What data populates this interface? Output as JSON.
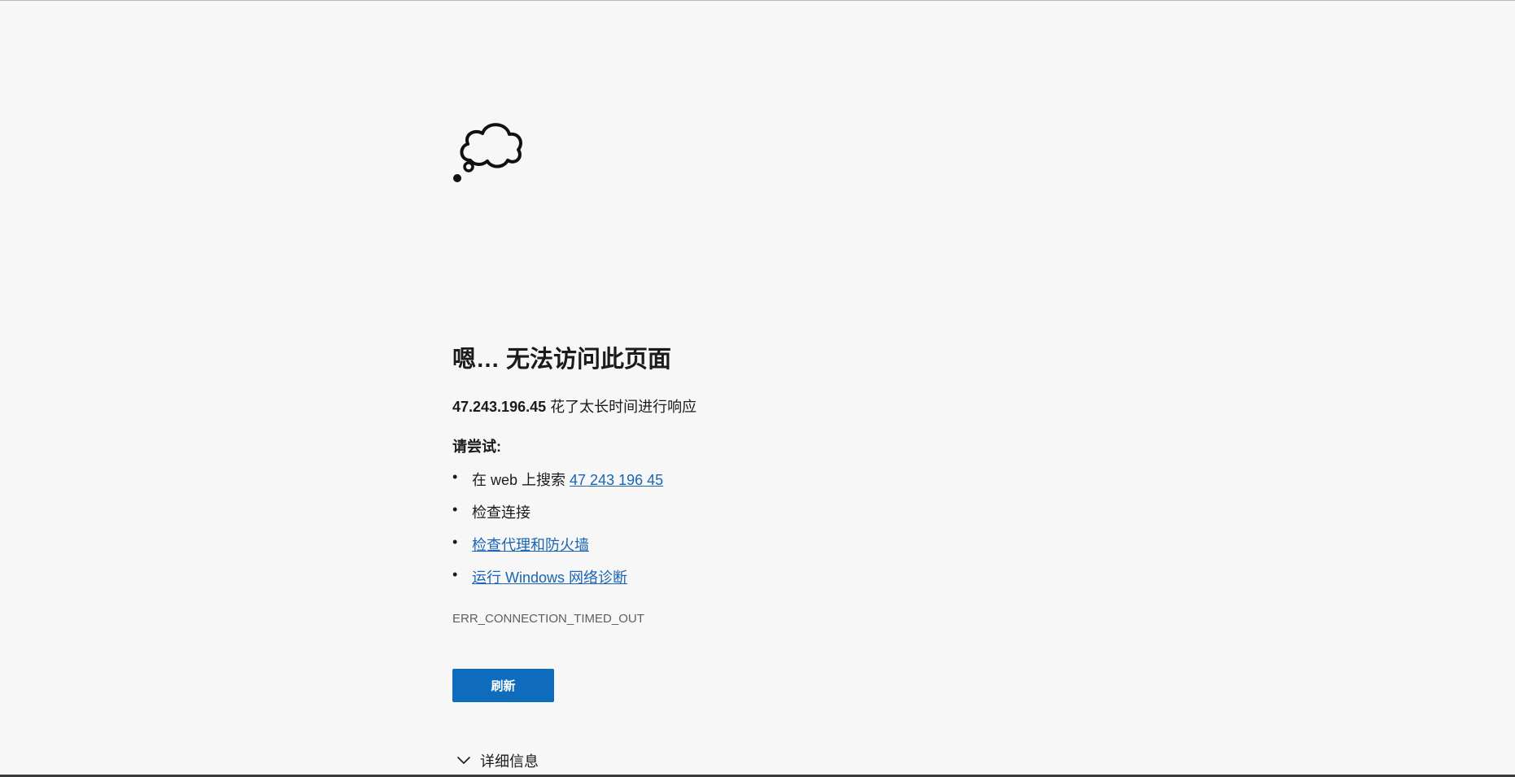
{
  "error_page": {
    "title": "嗯… 无法访问此页面",
    "host": "47.243.196.45",
    "message": " 花了太长时间进行响应",
    "try_label": "请尝试:",
    "suggestions": [
      {
        "bullet": "•",
        "prefix": "在 web 上搜索 ",
        "link": "47 243 196 45"
      },
      {
        "bullet": "•",
        "text": "检查连接"
      },
      {
        "bullet": "•",
        "link": "检查代理和防火墙"
      },
      {
        "bullet": "•",
        "link": "运行 Windows 网络诊断"
      }
    ],
    "error_code": "ERR_CONNECTION_TIMED_OUT",
    "refresh_label": "刷新",
    "details_label": "详细信息"
  },
  "icons": {
    "cloud": "thought-cloud-icon",
    "chevron": "chevron-down-icon"
  },
  "colors": {
    "background": "#f7f7f7",
    "link": "#1a65b3",
    "button": "#0f6cbd",
    "error_code": "#5e5e5e"
  }
}
